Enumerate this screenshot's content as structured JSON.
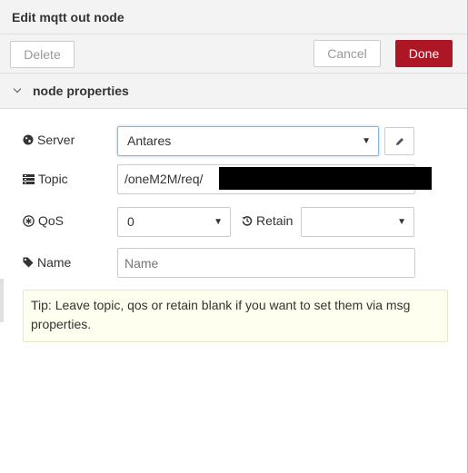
{
  "dialog": {
    "title": "Edit mqtt out node"
  },
  "toolbar": {
    "delete_label": "Delete",
    "cancel_label": "Cancel",
    "done_label": "Done"
  },
  "section": {
    "title": "node properties",
    "expanded": true
  },
  "form": {
    "server": {
      "label": "Server",
      "value": "Antares"
    },
    "topic": {
      "label": "Topic",
      "value": "/oneM2M/req/"
    },
    "qos": {
      "label": "QoS",
      "value": "0"
    },
    "retain": {
      "label": "Retain",
      "value": ""
    },
    "name": {
      "label": "Name",
      "value": "",
      "placeholder": "Name"
    }
  },
  "tip": {
    "text": "Tip: Leave topic, qos or retain blank if you want to set them via msg properties."
  },
  "colors": {
    "done_button": "#ad1625",
    "tip_background": "#ffffef",
    "focus_border": "#85b7e3"
  },
  "icons": {
    "server": "globe-icon",
    "topic": "list-icon",
    "qos": "asterisk-circle-icon",
    "retain": "history-icon",
    "name": "tag-icon",
    "edit": "pencil-icon",
    "section": "chevron-down-icon"
  }
}
